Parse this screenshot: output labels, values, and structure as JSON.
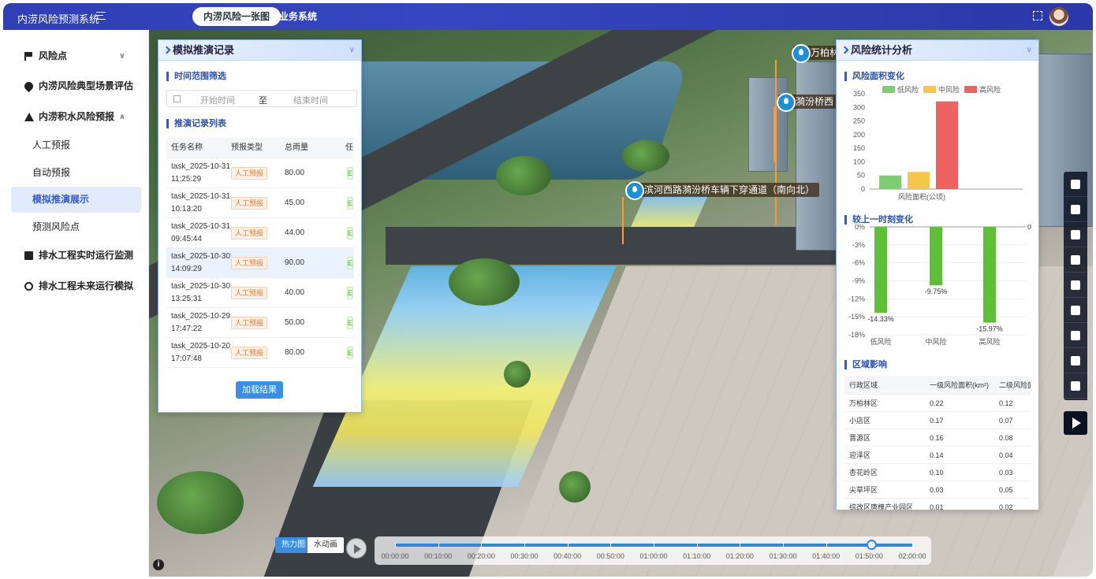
{
  "header": {
    "title": "内涝风险预测系统",
    "tabs": [
      "内涝风险一张图",
      "业务系统"
    ]
  },
  "sidebar": {
    "items": [
      {
        "label": "风险点",
        "icon": "flag-icon",
        "expandable": true,
        "active": false
      },
      {
        "label": "内涝风险典型场景评估",
        "icon": "location-pin-icon",
        "expandable": false,
        "active": false
      },
      {
        "label": "内涝积水风险预报",
        "icon": "warning-triangle-icon",
        "expandable": true,
        "active": false
      },
      {
        "label": "人工预报",
        "active": false
      },
      {
        "label": "自动预报",
        "active": false
      },
      {
        "label": "模拟推演展示",
        "active": true
      },
      {
        "label": "预测风险点",
        "active": false
      },
      {
        "label": "排水工程实时运行监测",
        "icon": "chart-icon",
        "expandable": true,
        "active": false
      },
      {
        "label": "排水工程未来运行模拟",
        "icon": "target-icon",
        "expandable": true,
        "active": false
      }
    ]
  },
  "map": {
    "markers": [
      "万柏林",
      "漪汾桥西",
      "滨河西路漪汾桥车辆下穿通道（南向北）"
    ],
    "view_modes": [
      "热力图",
      "水动画"
    ],
    "timeline": [
      "00:00:00",
      "00:10:00",
      "00:20:00",
      "00:30:00",
      "00:40:00",
      "00:50:00",
      "01:00:00",
      "01:10:00",
      "01:20:00",
      "01:30:00",
      "01:40:00",
      "01:50:00",
      "02:00:00"
    ],
    "timeline_progress": 0.92,
    "tool_icons": [
      "layers-icon",
      "hand-icon",
      "eye-icon",
      "cloud-icon",
      "tools-icon",
      "location-icon",
      "print-icon",
      "settings-icon",
      "help-icon"
    ],
    "info": "i"
  },
  "left_panel": {
    "title": "模拟推演记录",
    "time_filter_title": "时间范围筛选",
    "start_placeholder": "开始时间",
    "sep": "至",
    "end_placeholder": "结束时间",
    "list_title": "推演记录列表",
    "columns": [
      "任务名称",
      "预报类型",
      "总雨量",
      "任"
    ],
    "rows": [
      {
        "name1": "task_2025-10-31",
        "name2": "11:25:29",
        "type": "人工预报",
        "rain": "80.00",
        "status": "E"
      },
      {
        "name1": "task_2025-10-31",
        "name2": "10:13:20",
        "type": "人工预报",
        "rain": "45.00",
        "status": "E"
      },
      {
        "name1": "task_2025-10-31",
        "name2": "09:45:44",
        "type": "人工预报",
        "rain": "44.00",
        "status": "E"
      },
      {
        "name1": "task_2025-10-30",
        "name2": "14:09:29",
        "type": "人工预报",
        "rain": "90.00",
        "status": "E"
      },
      {
        "name1": "task_2025-10-30",
        "name2": "13:25:31",
        "type": "人工预报",
        "rain": "40.00",
        "status": "E"
      },
      {
        "name1": "task_2025-10-29",
        "name2": "17:47:22",
        "type": "人工预报",
        "rain": "50.00",
        "status": "E"
      },
      {
        "name1": "task_2025-10-20",
        "name2": "17:07:48",
        "type": "人工预报",
        "rain": "80.00",
        "status": "E"
      }
    ],
    "load_button": "加载结果"
  },
  "right_panel": {
    "title": "风险统计分析",
    "area_title": "风险面积变化",
    "change_title": "较上一时刻变化",
    "region_title": "区域影响",
    "region_columns": [
      "行政区域",
      "一级风险面积(km²)",
      "二级风险面"
    ],
    "regions": [
      {
        "name": "万柏林区",
        "l1": "0.22",
        "l2": "0.12"
      },
      {
        "name": "小店区",
        "l1": "0.17",
        "l2": "0.07"
      },
      {
        "name": "晋源区",
        "l1": "0.16",
        "l2": "0.08"
      },
      {
        "name": "迎泽区",
        "l1": "0.14",
        "l2": "0.04"
      },
      {
        "name": "杏花岭区",
        "l1": "0.10",
        "l2": "0.03"
      },
      {
        "name": "尖草坪区",
        "l1": "0.03",
        "l2": "0.05"
      },
      {
        "name": "综改区唐槐产业园区",
        "l1": "0.01",
        "l2": "0.02"
      }
    ]
  },
  "chart_data": [
    {
      "type": "bar",
      "categories": [
        "风险面积(公顷)"
      ],
      "series": [
        {
          "name": "低风险",
          "values": [
            50
          ],
          "color": "#7ccf6e"
        },
        {
          "name": "中风险",
          "values": [
            63
          ],
          "color": "#f6c64a"
        },
        {
          "name": "高风险",
          "values": [
            322
          ],
          "color": "#ee6262"
        }
      ],
      "ylim": [
        0,
        350
      ],
      "yticks": [
        0,
        50,
        100,
        150,
        200,
        250,
        300,
        350
      ],
      "legend": "top"
    },
    {
      "type": "bar",
      "categories": [
        "低风险",
        "中风险",
        "高风险"
      ],
      "values": [
        -14.33,
        -9.75,
        -15.97
      ],
      "labels": [
        "-14.33%",
        "-9.75%",
        "-15.97%"
      ],
      "ylim": [
        -18,
        0
      ],
      "yticks": [
        "0%",
        "-3%",
        "-6%",
        "-9%",
        "-12%",
        "-15%",
        "-18%"
      ],
      "right_label": "0",
      "color": "#5fbf36"
    }
  ]
}
